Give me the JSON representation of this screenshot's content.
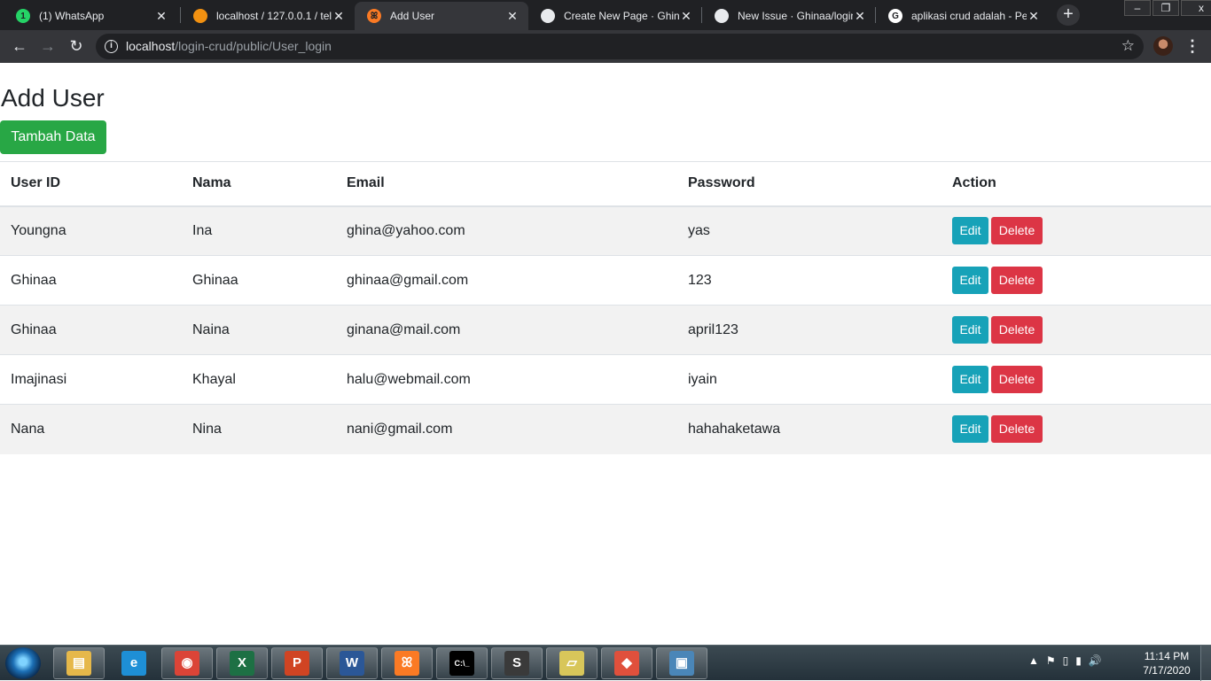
{
  "browser": {
    "tabs": [
      {
        "title": "(1) WhatsApp",
        "favicon": "whatsapp-icon",
        "favicon_text": "1",
        "favicon_color": "#25d366"
      },
      {
        "title": "localhost / 127.0.0.1 / tel",
        "favicon": "phpmyadmin-icon",
        "favicon_text": "",
        "favicon_color": "#f29111"
      },
      {
        "title": "Add User",
        "favicon": "xampp-icon",
        "favicon_text": "ꕤ",
        "favicon_color": "#fb7a24",
        "active": true
      },
      {
        "title": "Create New Page · Ghina",
        "favicon": "github-icon",
        "favicon_text": "",
        "favicon_color": "#e8eaed"
      },
      {
        "title": "New Issue · Ghinaa/login",
        "favicon": "github-icon",
        "favicon_text": "",
        "favicon_color": "#e8eaed"
      },
      {
        "title": "aplikasi crud adalah - Pe",
        "favicon": "google-icon",
        "favicon_text": "G",
        "favicon_color": "#ffffff"
      }
    ],
    "new_tab_label": "+",
    "window_controls": {
      "minimize": "–",
      "maximize": "❐",
      "close": "x"
    },
    "url_host": "localhost",
    "url_path": "/login-crud/public/User_login",
    "back": "←",
    "forward": "→",
    "reload": "↻",
    "star": "☆",
    "menu": "⋮"
  },
  "page": {
    "title": "Add User",
    "add_button": "Tambah Data",
    "columns": [
      "User ID",
      "Nama",
      "Email",
      "Password",
      "Action"
    ],
    "rows": [
      {
        "user_id": "Youngna",
        "nama": "Ina",
        "email": "ghina@yahoo.com",
        "password": "yas"
      },
      {
        "user_id": "Ghinaa",
        "nama": "Ghinaa",
        "email": "ghinaa@gmail.com",
        "password": "123"
      },
      {
        "user_id": "Ghinaa",
        "nama": "Naina",
        "email": "ginana@mail.com",
        "password": "april123"
      },
      {
        "user_id": "Imajinasi",
        "nama": "Khayal",
        "email": "halu@webmail.com",
        "password": "iyain"
      },
      {
        "user_id": "Nana",
        "nama": "Nina",
        "email": "nani@gmail.com",
        "password": "hahahaketawa"
      }
    ],
    "edit_label": "Edit",
    "delete_label": "Delete",
    "colors": {
      "add": "#28a745",
      "edit": "#17a2b8",
      "delete": "#dc3545"
    }
  },
  "taskbar": {
    "apps": [
      {
        "name": "windows-explorer-icon",
        "glyph": "▤",
        "color": "#e6b84a"
      },
      {
        "name": "internet-explorer-icon",
        "glyph": "e",
        "color": "#1e8fd6"
      },
      {
        "name": "chrome-icon",
        "glyph": "◉",
        "color": "#db4437"
      },
      {
        "name": "excel-icon",
        "glyph": "X",
        "color": "#1d7044"
      },
      {
        "name": "powerpoint-icon",
        "glyph": "P",
        "color": "#d04423"
      },
      {
        "name": "word-icon",
        "glyph": "W",
        "color": "#2b5797"
      },
      {
        "name": "xampp-icon",
        "glyph": "ꕤ",
        "color": "#fb7a24"
      },
      {
        "name": "command-prompt-icon",
        "glyph": "C:\\_",
        "color": "#000000"
      },
      {
        "name": "sublime-text-icon",
        "glyph": "S",
        "color": "#3a3a3a"
      },
      {
        "name": "sticky-notes-icon",
        "glyph": "▱",
        "color": "#d8c65a"
      },
      {
        "name": "git-icon",
        "glyph": "◆",
        "color": "#e0503c"
      },
      {
        "name": "photo-viewer-icon",
        "glyph": "▣",
        "color": "#4a86b8"
      }
    ],
    "time": "11:14 PM",
    "date": "7/17/2020",
    "tray_icons": [
      "▲",
      "⚑",
      "▯",
      "▮",
      "🔊"
    ]
  }
}
